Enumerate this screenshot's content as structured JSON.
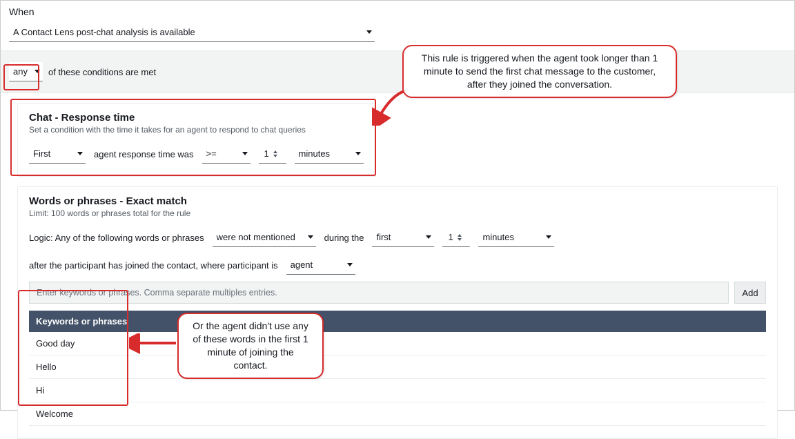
{
  "when": {
    "label": "When",
    "trigger": "A Contact Lens post-chat analysis is available"
  },
  "band": {
    "anySelect": "any",
    "tail": "of these conditions are met"
  },
  "responseCard": {
    "title": "Chat - Response time",
    "subtitle": "Set a condition with the time it takes for an agent to respond to chat queries",
    "position": "First",
    "middle": "agent response time was",
    "comparator": ">=",
    "value": "1",
    "unit": "minutes"
  },
  "wordsCard": {
    "title": "Words or phrases - Exact match",
    "subtitle": "Limit: 100 words or phrases total for the rule",
    "logicLead": "Logic: Any of the following words or phrases",
    "mentioned": "were not mentioned",
    "duringLabel": "during the",
    "duringValue": "first",
    "count": "1",
    "unit": "minutes",
    "tail": "after the participant has joined the contact, where participant is",
    "participant": "agent",
    "inputPlaceholder": "Enter keywords or phrases. Comma separate multiples entries.",
    "addLabel": "Add",
    "tableHeader": "Keywords or phrases",
    "rows": [
      "Good day",
      "Hello",
      "Hi",
      "Welcome"
    ]
  },
  "annotations": {
    "callout1": "This rule is triggered when the agent took longer than 1 minute to send the first chat message to the customer, after they joined the conversation.",
    "callout2": "Or the agent didn't use any of these words in the first 1 minute of joining the contact."
  }
}
